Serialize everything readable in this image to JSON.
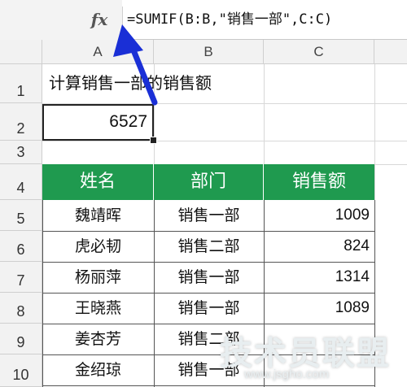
{
  "formula_bar": {
    "fx_label": "fx",
    "formula": "=SUMIF(B:B,\"销售一部\",C:C)"
  },
  "columns": [
    "A",
    "B",
    "C"
  ],
  "rows": [
    "1",
    "2",
    "3",
    "4",
    "5",
    "6",
    "7",
    "8",
    "9",
    "10"
  ],
  "cells": {
    "a1": "计算销售一部的销售额",
    "a2": "6527"
  },
  "table": {
    "headers": [
      "姓名",
      "部门",
      "销售额"
    ],
    "rows": [
      {
        "name": "魏靖晖",
        "dept": "销售一部",
        "sales": "1009"
      },
      {
        "name": "虎必韧",
        "dept": "销售二部",
        "sales": "824"
      },
      {
        "name": "杨丽萍",
        "dept": "销售一部",
        "sales": "1314"
      },
      {
        "name": "王晓燕",
        "dept": "销售一部",
        "sales": "1089"
      },
      {
        "name": "姜杏芳",
        "dept": "销售二部",
        "sales": ""
      },
      {
        "name": "金绍琼",
        "dept": "销售一部",
        "sales": ""
      }
    ]
  },
  "colors": {
    "header_green": "#1f9a4f",
    "arrow_blue": "#1a2fd6"
  },
  "watermark": {
    "text": "技术员联盟",
    "url": "www.jsgho.com"
  }
}
